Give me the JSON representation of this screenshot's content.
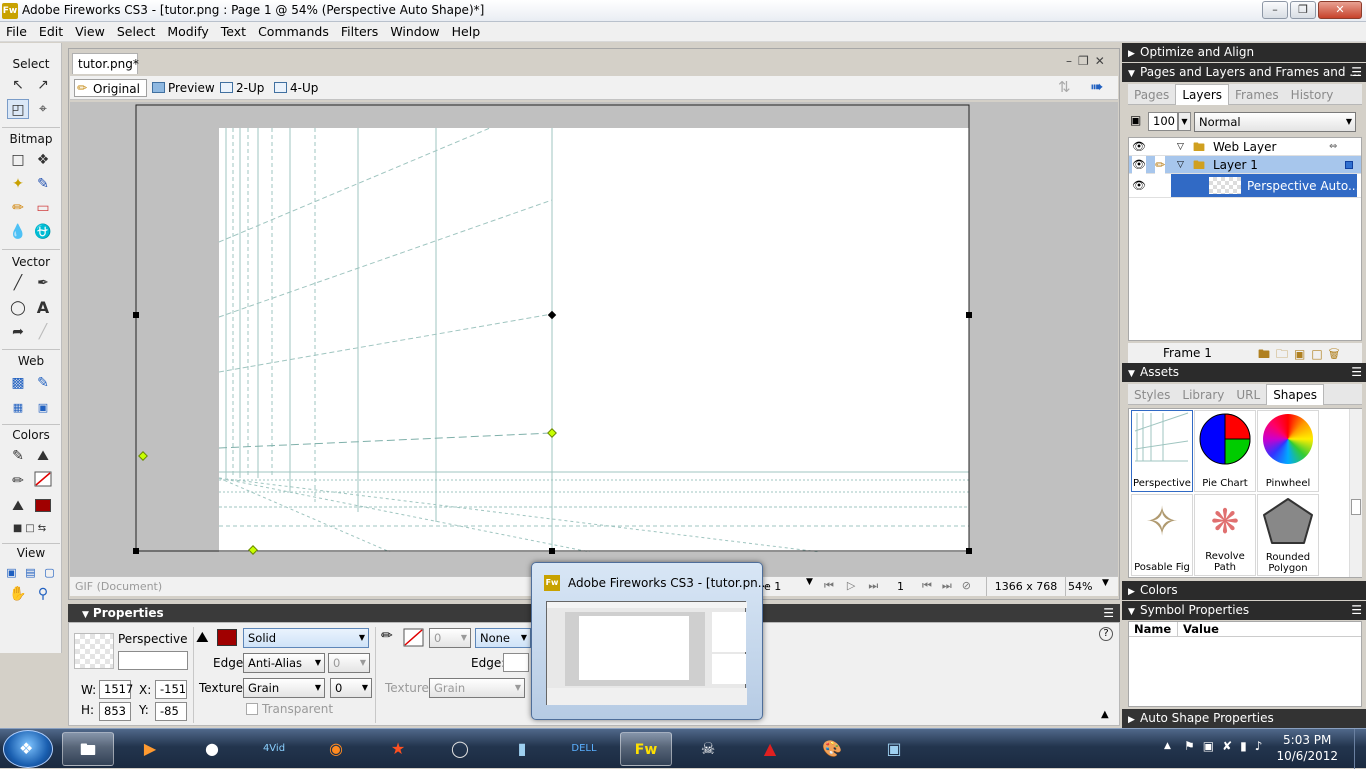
{
  "window": {
    "title": "Adobe Fireworks CS3 - [tutor.png : Page 1 @  54% (Perspective Auto Shape)*]",
    "app_icon": "Fw",
    "controls": [
      "minimize",
      "maximize",
      "close"
    ]
  },
  "menu": [
    "File",
    "Edit",
    "View",
    "Select",
    "Modify",
    "Text",
    "Commands",
    "Filters",
    "Window",
    "Help"
  ],
  "tools": {
    "sections": [
      "Select",
      "Bitmap",
      "Vector",
      "Web",
      "Colors",
      "View"
    ]
  },
  "document": {
    "tab": "tutor.png*",
    "view_buttons": [
      "Original",
      "Preview",
      "2-Up",
      "4-Up"
    ],
    "status": {
      "format": "GIF (Document)",
      "frame_label": "e 1",
      "frame_number": "1",
      "size": "1366 x 768",
      "zoom": "54%"
    }
  },
  "properties": {
    "header": "Properties",
    "object_name": "Perspective",
    "fill_type": "Solid",
    "fill_color": "#a00000",
    "edge_label": "Edge:",
    "edge": "Anti-Alias",
    "edge_value": "0",
    "texture_label": "Texture:",
    "texture": "Grain",
    "texture_value": "0",
    "transparent_label": "Transparent",
    "stroke_size": "0",
    "stroke": "None",
    "stroke_edge_label": "Edge:",
    "stroke_texture_label": "Texture:",
    "stroke_texture": "Grain",
    "w_label": "W:",
    "w": "1517",
    "h_label": "H:",
    "h": "853",
    "x_label": "X:",
    "x": "-151",
    "y_label": "Y:",
    "y": "-85",
    "help": "?"
  },
  "panels": {
    "optimize": "Optimize and Align",
    "pages_layers": "Pages and Layers and Frames and ...",
    "tabs": [
      "Pages",
      "Layers",
      "Frames",
      "History"
    ],
    "active_tab": "Layers",
    "opacity": "100",
    "blend": "Normal",
    "layers": [
      {
        "name": "Web Layer"
      },
      {
        "name": "Layer 1"
      },
      {
        "name": "Perspective Auto..."
      }
    ],
    "frame": "Frame 1",
    "assets": "Assets",
    "asset_tabs": [
      "Styles",
      "Library",
      "URL",
      "Shapes"
    ],
    "asset_active": "Shapes",
    "shapes": [
      "Perspective",
      "Pie Chart",
      "Pinwheel",
      "Posable Fig",
      "Revolve Path",
      "Rounded Polygon"
    ],
    "colors": "Colors",
    "symbol_props": "Symbol Properties",
    "symbol_cols": [
      "Name",
      "Value"
    ],
    "auto_shape": "Auto Shape Properties"
  },
  "taskbar_preview": {
    "title": "Adobe Fireworks CS3 - [tutor.pn..."
  },
  "taskbar": {
    "time": "5:03 PM",
    "date": "10/6/2012",
    "icons": [
      "explorer-icon",
      "media-player-icon",
      "photo-icon",
      "4video-icon",
      "firefox-icon",
      "game-icon",
      "drive-icon",
      "app-icon",
      "dell-icon",
      "fireworks-icon",
      "darth-vader-icon",
      "app-red-icon",
      "paint-icon",
      "display-icon"
    ]
  },
  "colors": {
    "accent": "#316ac5",
    "fill": "#a00000",
    "selection": "#a7c6ec"
  }
}
